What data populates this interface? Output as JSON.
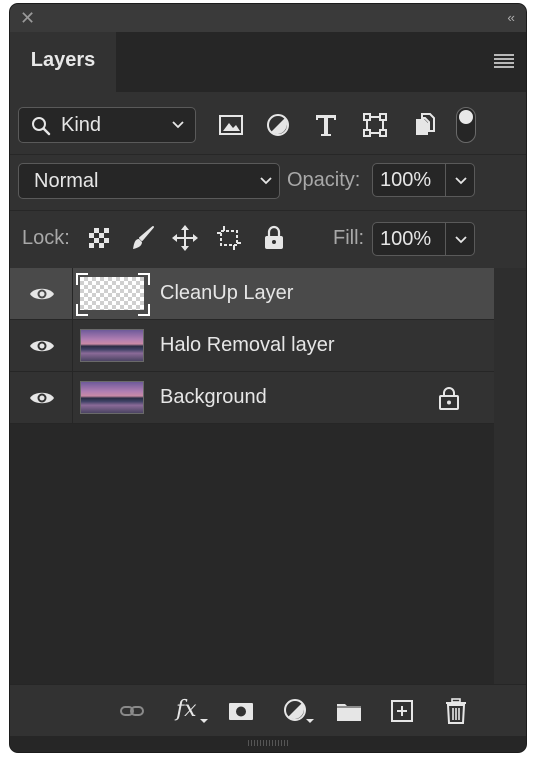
{
  "panel": {
    "tab_label": "Layers"
  },
  "filter": {
    "kind_label": "Kind",
    "filter_icons": [
      "image-filter-icon",
      "adjustment-filter-icon",
      "type-filter-icon",
      "shape-filter-icon",
      "smart-object-filter-icon"
    ]
  },
  "blend": {
    "mode": "Normal",
    "opacity_label": "Opacity:",
    "opacity_value": "100%"
  },
  "lock": {
    "label": "Lock:",
    "fill_label": "Fill:",
    "fill_value": "100%"
  },
  "layers": [
    {
      "name": "CleanUp Layer",
      "selected": true,
      "visible": true,
      "thumbnail": "transparent",
      "locked": false
    },
    {
      "name": "Halo Removal layer",
      "selected": false,
      "visible": true,
      "thumbnail": "photo",
      "locked": false
    },
    {
      "name": "Background",
      "selected": false,
      "visible": true,
      "thumbnail": "photo",
      "locked": true
    }
  ],
  "footer": {
    "fx_label": "fx",
    "icons": [
      "link-icon",
      "fx-icon",
      "mask-icon",
      "adjustment-icon",
      "folder-icon",
      "new-layer-icon",
      "trash-icon"
    ]
  },
  "colors": {
    "panel_bg": "#323232",
    "selected_row": "#4a4a4a",
    "text": "#e6e6e6"
  }
}
